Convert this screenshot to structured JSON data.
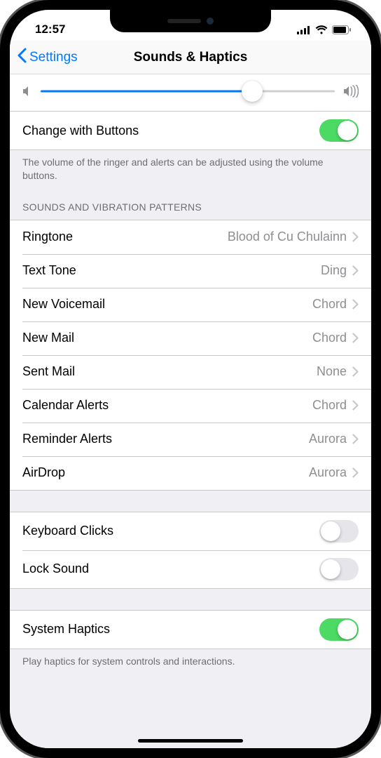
{
  "statusBar": {
    "time": "12:57"
  },
  "nav": {
    "back": "Settings",
    "title": "Sounds & Haptics"
  },
  "volumeSlider": {
    "percent": 72
  },
  "changeWithButtons": {
    "label": "Change with Buttons",
    "on": true
  },
  "volumeFooter": "The volume of the ringer and alerts can be adjusted using the volume buttons.",
  "patternsHeader": "Sounds and Vibration Patterns",
  "patterns": [
    {
      "label": "Ringtone",
      "value": "Blood of Cu Chulainn"
    },
    {
      "label": "Text Tone",
      "value": "Ding"
    },
    {
      "label": "New Voicemail",
      "value": "Chord"
    },
    {
      "label": "New Mail",
      "value": "Chord"
    },
    {
      "label": "Sent Mail",
      "value": "None"
    },
    {
      "label": "Calendar Alerts",
      "value": "Chord"
    },
    {
      "label": "Reminder Alerts",
      "value": "Aurora"
    },
    {
      "label": "AirDrop",
      "value": "Aurora"
    }
  ],
  "keyboardClicks": {
    "label": "Keyboard Clicks",
    "on": false
  },
  "lockSound": {
    "label": "Lock Sound",
    "on": false
  },
  "systemHaptics": {
    "label": "System Haptics",
    "on": true
  },
  "hapticsFooter": "Play haptics for system controls and interactions."
}
